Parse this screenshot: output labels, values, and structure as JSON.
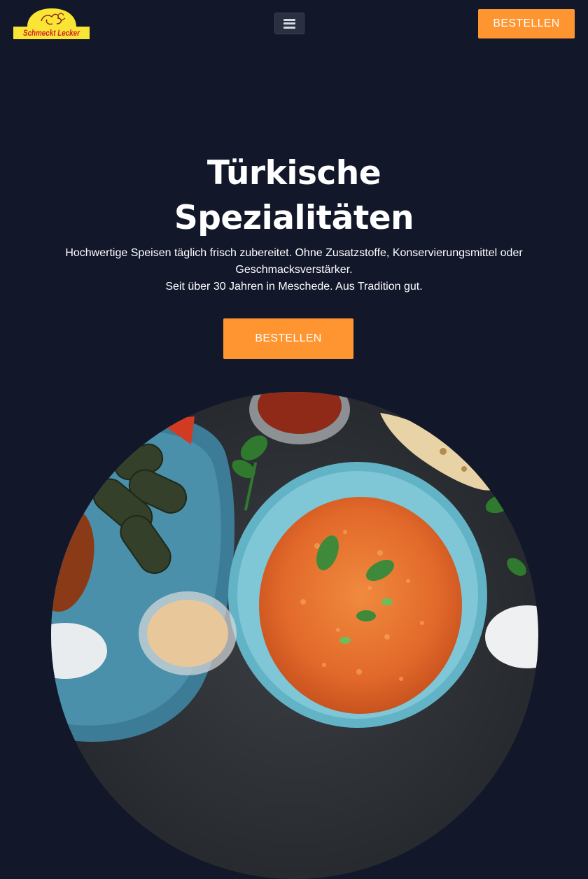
{
  "header": {
    "logo_text": "Schmeckt Lecker",
    "menu_icon": "hamburger-icon",
    "order_button_label": "BESTELLEN"
  },
  "hero": {
    "title_line1": "Türkische",
    "title_line2": "Spezialitäten",
    "subtitle_line1": "Hochwertige Speisen täglich frisch zubereitet. Ohne Zusatzstoffe, Konservierungsmittel oder Geschmacksverstärker.",
    "subtitle_line2": "Seit über 30 Jahren in Meschede. Aus Tradition gut.",
    "order_button_label": "BESTELLEN"
  },
  "colors": {
    "background": "#12172a",
    "accent": "#fe9530",
    "logo_yellow": "#f9e534",
    "logo_red": "#d0202c"
  }
}
